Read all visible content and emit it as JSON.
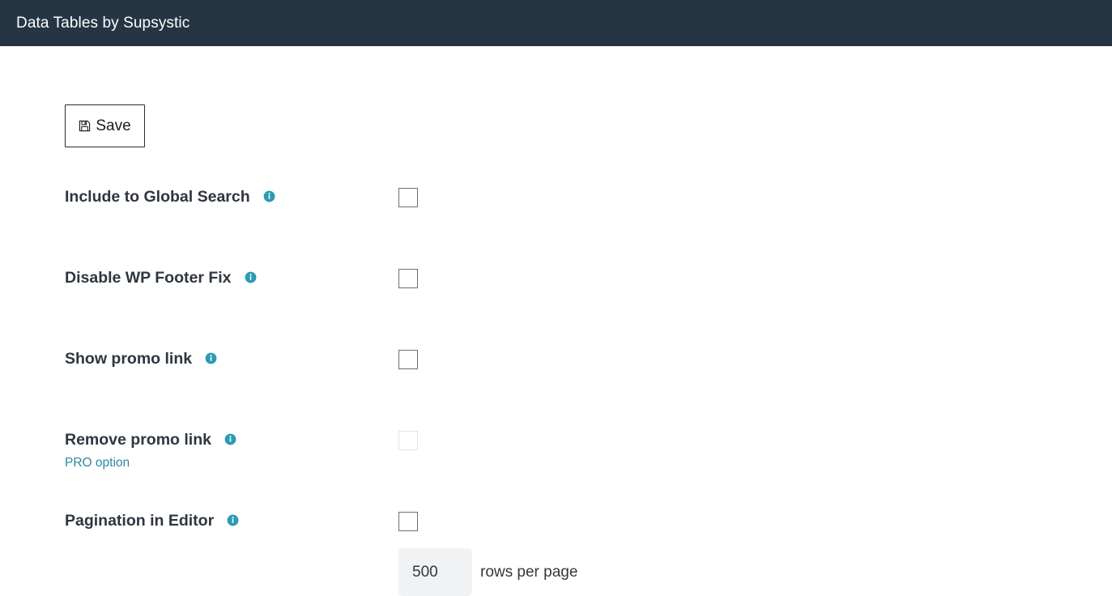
{
  "header": {
    "title": "Data Tables by Supsystic",
    "background_color": "#253544",
    "text_color": "#ffffff"
  },
  "toolbar": {
    "save_label": "Save",
    "save_icon": "floppy-disk-icon"
  },
  "colors": {
    "accent_teal": "#2a9cb5",
    "pro_link": "#2a87a0",
    "label_text": "#2e3640",
    "checkbox_border": "#6f6f6f",
    "checkbox_border_disabled": "#e2e2e2",
    "input_background": "#f1f2f3"
  },
  "settings": [
    {
      "label": "Include to Global Search",
      "info_icon": "info-icon",
      "sub_label": "",
      "checked": false,
      "disabled": false
    },
    {
      "label": "Disable WP Footer Fix",
      "info_icon": "info-icon",
      "sub_label": "",
      "checked": false,
      "disabled": false
    },
    {
      "label": "Show promo link",
      "info_icon": "info-icon",
      "sub_label": "",
      "checked": false,
      "disabled": false
    },
    {
      "label": "Remove promo link",
      "info_icon": "info-icon",
      "sub_label": "PRO option",
      "checked": false,
      "disabled": true
    },
    {
      "label": "Pagination in Editor",
      "info_icon": "info-icon",
      "sub_label": "",
      "checked": false,
      "disabled": false
    }
  ],
  "rows_per_page": {
    "value": "500",
    "placeholder": "500",
    "suffix_label": "rows per page"
  }
}
